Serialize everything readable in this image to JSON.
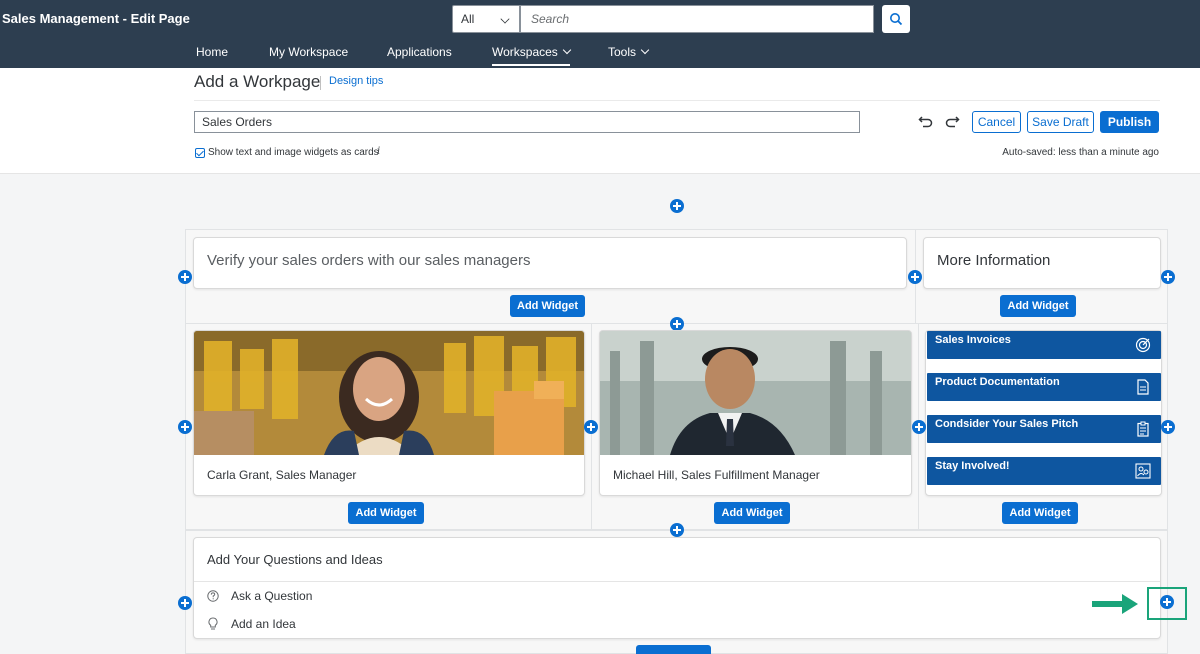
{
  "shell": {
    "title": "Sales Management - Edit Page",
    "scope_value": "All",
    "search_placeholder": "Search",
    "nav": [
      "Home",
      "My Workspace",
      "Applications",
      "Workspaces",
      "Tools"
    ]
  },
  "editor": {
    "page_title": "Add a Workpage",
    "design_tips": "Design tips",
    "title_value": "Sales Orders",
    "cancel": "Cancel",
    "save_draft": "Save Draft",
    "publish": "Publish",
    "show_cards_label": "Show text and image widgets as cards",
    "show_cards_checked": true,
    "autosave": "Auto-saved: less than a minute ago"
  },
  "canvas": {
    "add_widget": "Add Widget",
    "verify_text": "Verify your sales orders with our sales managers",
    "more_info": "More Information",
    "person1": "Carla Grant, Sales Manager",
    "person2": "Michael Hill, Sales Fulfillment Manager",
    "links": [
      "Sales Invoices",
      "Product Documentation",
      "Condsider Your Sales Pitch",
      "Stay Involved!"
    ],
    "link_icons": [
      "target-icon",
      "document-icon",
      "clipboard-icon",
      "people-icon"
    ],
    "questions_title": "Add Your Questions and Ideas",
    "ask_question": "Ask a Question",
    "add_idea": "Add an Idea"
  },
  "colors": {
    "shell": "#2d3e50",
    "accent": "#0a6ed1",
    "tile": "#0e56a0",
    "highlight": "#1aa47a"
  }
}
